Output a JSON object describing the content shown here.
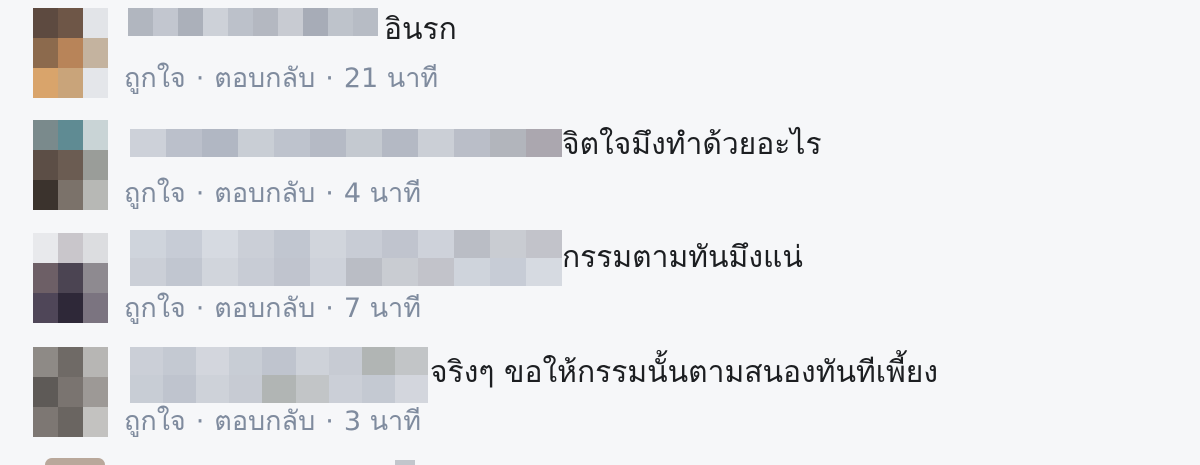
{
  "actions": {
    "like": "ถูกใจ",
    "reply": "ตอบกลับ",
    "separator": "·"
  },
  "comments": [
    {
      "text": "อินรก",
      "time": "21 นาที",
      "avatar_colors": [
        "#5d4a40",
        "#6e5647",
        "#e2e4e8",
        "#8c6a4d",
        "#b88459",
        "#c4b39f",
        "#d9a46b",
        "#c9a47a",
        "#e4e6ea"
      ],
      "name_colors": [
        "#a6abb6",
        "#b9bec8",
        "#9ea4b0",
        "#c7cbd3",
        "#b3b8c2",
        "#a9aeb8",
        "#c0c4cc",
        "#9aa0ac",
        "#b5bac4",
        "#adb2bc"
      ]
    },
    {
      "text": "จิตใจมึงทำด้วยอะไร",
      "time": "4 นาที",
      "avatar_colors": [
        "#7a8a8c",
        "#5f8b93",
        "#c9d4d6",
        "#5c4e46",
        "#6b5c52",
        "#9a9d99",
        "#3b332d",
        "#7b726a",
        "#b7b8b5"
      ],
      "name_colors": [
        "#c6cbd4",
        "#b1b7c3",
        "#a6adba",
        "#c2c7cf",
        "#b5bbc6",
        "#aab0bd",
        "#bcc1ca",
        "#a9afbb",
        "#c4c9d1",
        "#b0b5c0",
        "#a7aab2",
        "#9e9aa3"
      ]
    },
    {
      "text": "กรรมตามทันมึงแน่",
      "time": "7 นาที",
      "avatar_colors": [
        "#e8e9ec",
        "#c9c6cb",
        "#dcdde0",
        "#6d5f66",
        "#4b4452",
        "#8e8a90",
        "#4f4658",
        "#2e2838",
        "#7b7480"
      ],
      "name_colors": [
        "#c9ced8",
        "#bfc5d0",
        "#d1d5dd",
        "#c4c9d2",
        "#b8bec9",
        "#cbd0d8",
        "#c0c5cf",
        "#b7bcc7",
        "#c8ccd5",
        "#b0b4bd",
        "#c2c5cc",
        "#b9bbc2"
      ]
    },
    {
      "text": "จริงๆ ขอให้กรรมนั้นตามสนองทันทีเพี้ยง",
      "time": "3 นาที",
      "avatar_colors": [
        "#8e8a86",
        "#6f6a66",
        "#b7b6b4",
        "#5e5a57",
        "#7a7470",
        "#9d9996",
        "#7d7773",
        "#6a6561",
        "#c3c2c0"
      ],
      "name_colors": [
        "#c4c9d2",
        "#bcc2cc",
        "#cdd1d9",
        "#c1c6cf",
        "#b6bcc7",
        "#c8ccd4",
        "#bfc4cd",
        "#a5aaa8",
        "#b9bdbf"
      ]
    }
  ]
}
